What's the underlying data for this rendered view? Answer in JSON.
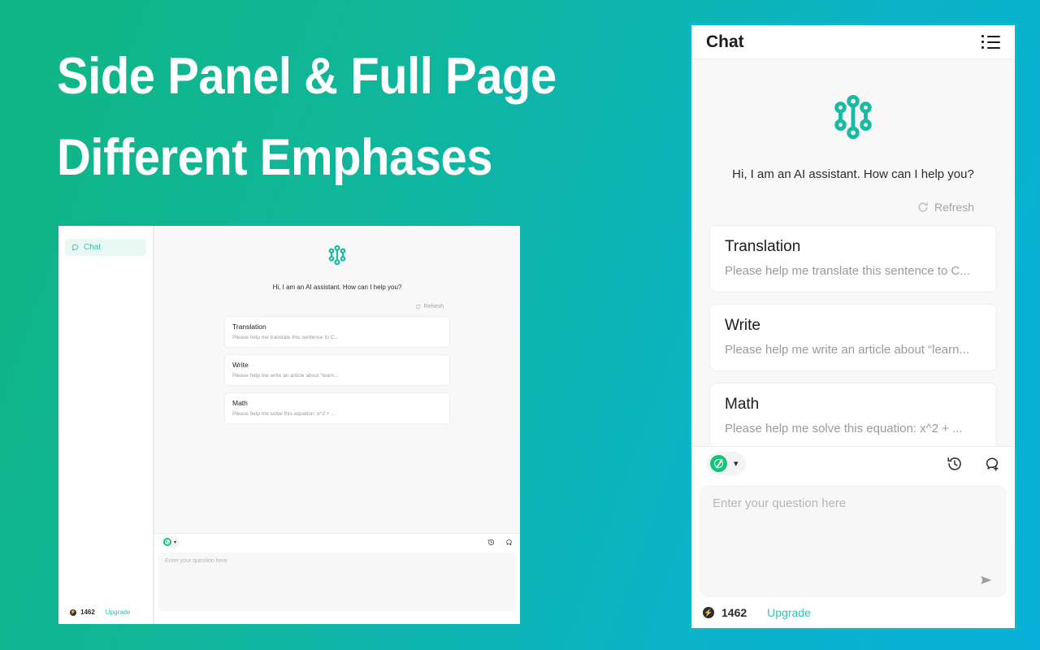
{
  "slide": {
    "headline_line1": "Side Panel & Full Page",
    "headline_line2": "Different Emphases",
    "background_start": "#11b583",
    "background_end": "#06b0d8",
    "accent": "#0cb8c9"
  },
  "chat_panel": {
    "title": "Chat",
    "menu_icon": "list-menu-icon",
    "logo_icon": "ai-assistant-logo-icon",
    "greeting": "Hi, I am an AI assistant. How can I help you?",
    "refresh_label": "Refresh",
    "refresh_icon": "refresh-icon",
    "cards": [
      {
        "title": "Translation",
        "subtitle": "Please help me translate this sentence to C..."
      },
      {
        "title": "Write",
        "subtitle": "Please help me write an article about “learn..."
      },
      {
        "title": "Math",
        "subtitle": "Please help me solve this equation: x^2 + ..."
      }
    ],
    "toolbar": {
      "model_logo_icon": "openai-logo-icon",
      "model_dropdown_icon": "chevron-down-icon",
      "history_icon": "history-clock-icon",
      "new_chat_icon": "new-chat-bubble-plus-icon"
    },
    "composer": {
      "placeholder": "Enter your question here",
      "value": "",
      "send_icon": "send-arrow-icon"
    },
    "footer": {
      "credits_icon": "bolt-badge-icon",
      "credits": "1462",
      "upgrade_label": "Upgrade",
      "upgrade_color": "#33c2b0"
    }
  },
  "inset_panel": {
    "sidebar": {
      "items": [
        {
          "label": "Chat",
          "icon": "chat-bubble-icon",
          "active": true
        }
      ],
      "footer": {
        "credits_icon": "bolt-badge-icon",
        "credits": "1462",
        "upgrade_label": "Upgrade"
      }
    },
    "main": {
      "logo_icon": "ai-assistant-logo-icon",
      "greeting": "Hi, I am an AI assistant. How can I help you?",
      "refresh_label": "Refresh",
      "cards": [
        {
          "title": "Translation",
          "subtitle": "Please help me translate this sentence to C..."
        },
        {
          "title": "Write",
          "subtitle": "Please help me write an article about “learn..."
        },
        {
          "title": "Math",
          "subtitle": "Please help me solve this equation: x^2 + ..."
        }
      ],
      "composer": {
        "placeholder": "Enter your question here"
      }
    }
  }
}
